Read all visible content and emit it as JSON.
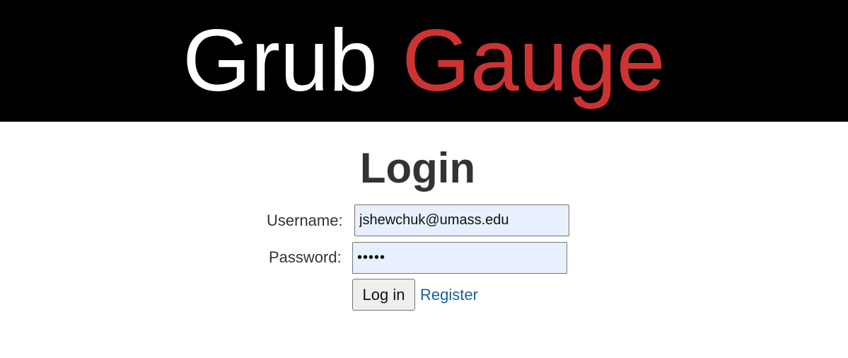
{
  "header": {
    "logo_word_1": "Grub",
    "logo_word_2": "Gauge",
    "background_color": "#000000",
    "logo_word_1_color": "#ffffff",
    "logo_word_2_color": "#cc3333"
  },
  "login_form": {
    "title": "Login",
    "username_label": "Username:",
    "username_value": "jshewchuk@umass.edu",
    "password_label": "Password:",
    "password_value": "•••••",
    "login_button_label": "Log in",
    "register_link_label": "Register",
    "link_color": "#1a5f9a"
  }
}
